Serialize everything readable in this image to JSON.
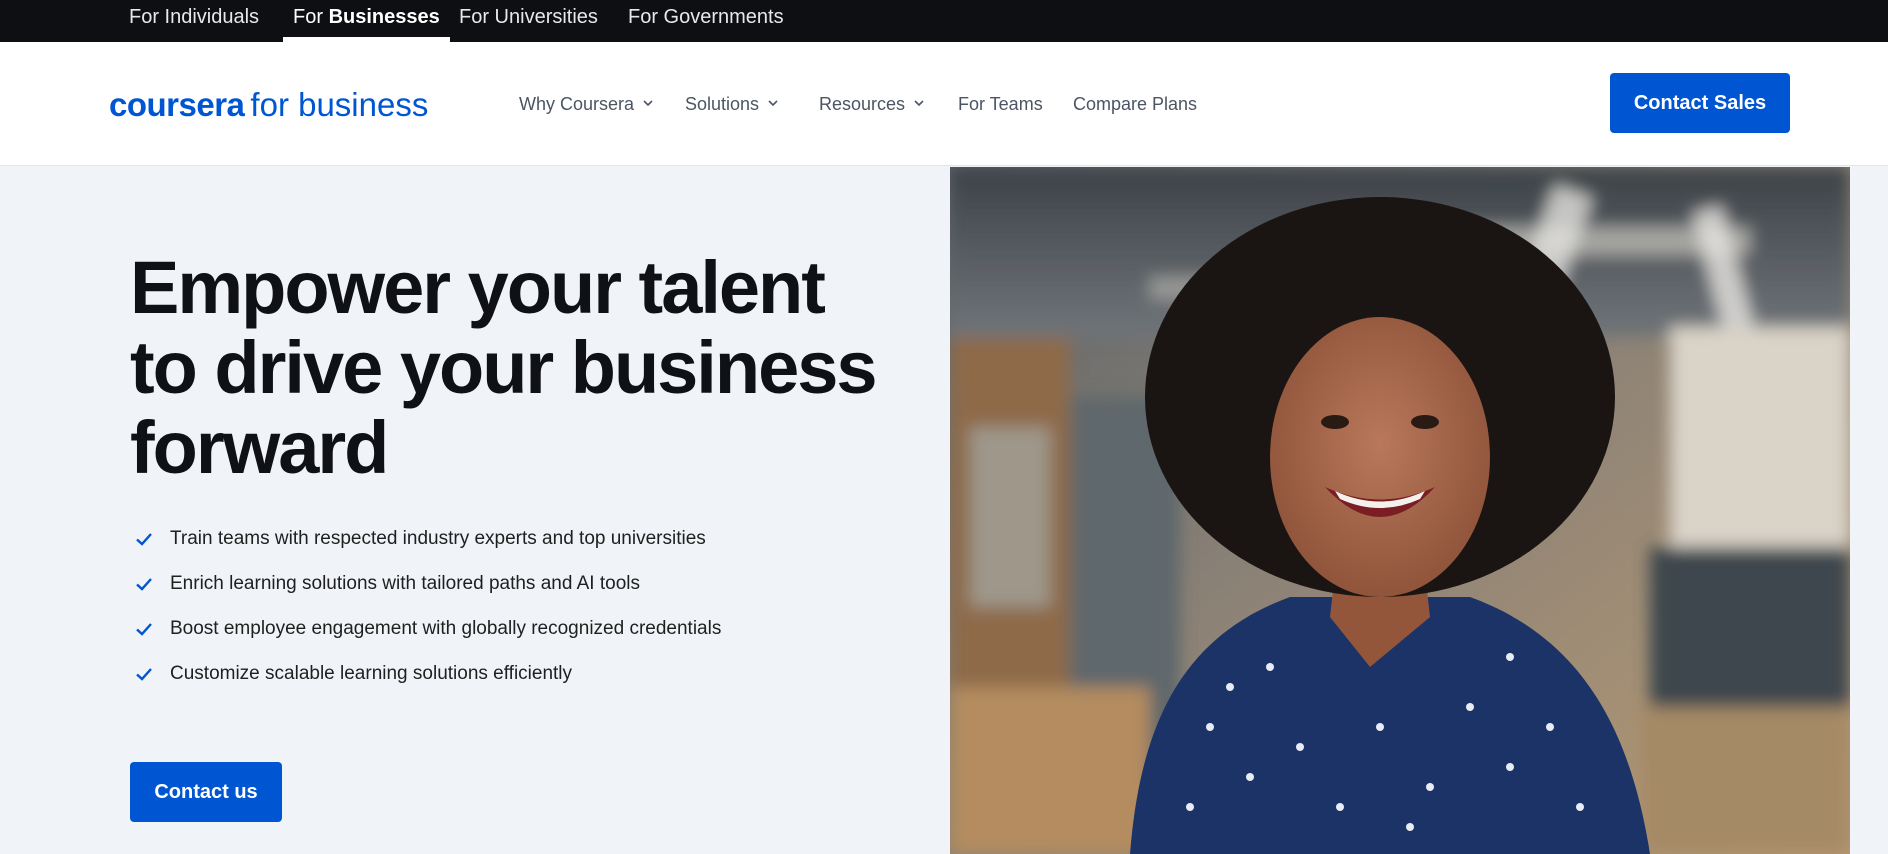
{
  "audience_nav": {
    "individuals": "For Individuals",
    "businesses_prefix": "For",
    "businesses_bold": "Businesses",
    "universities": "For Universities",
    "governments": "For Governments"
  },
  "header": {
    "logo_brand": "coursera",
    "logo_suffix": "for business",
    "nav": {
      "why_coursera": "Why Coursera",
      "solutions": "Solutions",
      "resources": "Resources",
      "for_teams": "For Teams",
      "compare_plans": "Compare Plans"
    },
    "contact_sales": "Contact Sales"
  },
  "hero": {
    "title": "Empower your talent to drive your business forward",
    "benefits": [
      "Train teams with respected industry experts and top universities",
      "Enrich learning solutions with tailored paths and AI tools",
      "Boost employee engagement with globally recognized credentials",
      "Customize scalable learning solutions efficiently"
    ],
    "cta": "Contact us"
  },
  "colors": {
    "brand_blue": "#0056d2",
    "top_bar": "#0e0f12",
    "hero_bg": "#f0f3f8"
  },
  "icons": {
    "check": "check-icon",
    "chevron": "chevron-down-icon"
  }
}
